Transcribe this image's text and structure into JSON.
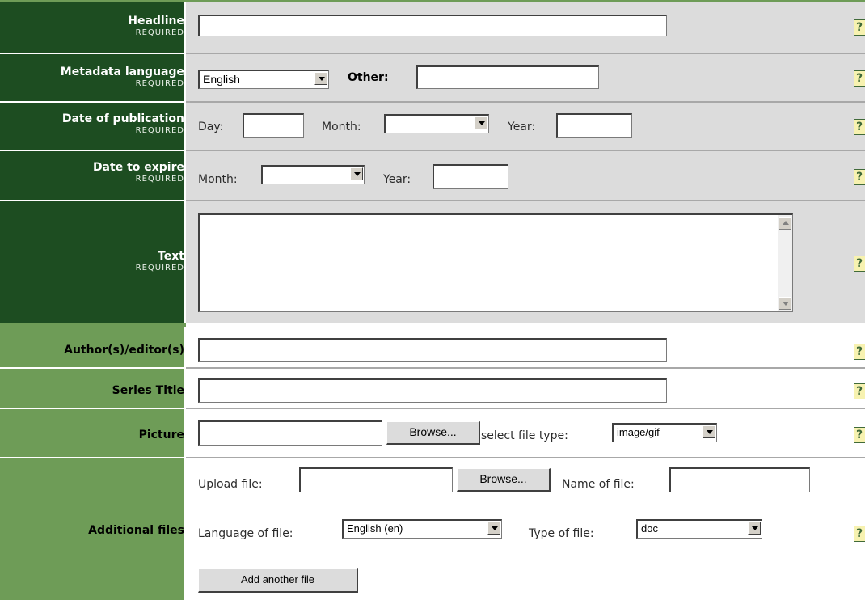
{
  "fields": {
    "headline": {
      "label": "Headline",
      "required": "REQUIRED",
      "value": ""
    },
    "metadata_language": {
      "label": "Metadata language",
      "required": "REQUIRED",
      "selected": "English",
      "other_label": "Other:",
      "other_value": ""
    },
    "date_of_publication": {
      "label": "Date of publication",
      "required": "REQUIRED",
      "day_label": "Day:",
      "day_value": "",
      "month_label": "Month:",
      "month_selected": "",
      "year_label": "Year:",
      "year_value": ""
    },
    "date_to_expire": {
      "label": "Date to expire",
      "required": "REQUIRED",
      "month_label": "Month:",
      "month_selected": "",
      "year_label": "Year:",
      "year_value": ""
    },
    "text": {
      "label": "Text",
      "required": "REQUIRED",
      "value": ""
    },
    "authors": {
      "label": "Author(s)/editor(s)",
      "value": ""
    },
    "series_title": {
      "label": "Series Title",
      "value": ""
    },
    "picture": {
      "label": "Picture",
      "value": "",
      "browse_label": "Browse...",
      "file_type_label": "select file type:",
      "file_type_selected": "image/gif"
    },
    "additional_files": {
      "label": "Additional files",
      "upload_label": "Upload file:",
      "upload_value": "",
      "browse_label": "Browse...",
      "name_label": "Name of file:",
      "name_value": "",
      "language_label": "Language of file:",
      "language_selected": "English  (en)",
      "type_label": "Type of file:",
      "type_selected": "doc",
      "add_button": "Add another file"
    }
  },
  "help": {
    "label": "?"
  },
  "colors": {
    "required_label_bg": "#1d4d21",
    "optional_label_bg": "#6e9c57",
    "field_bg_required": "#dcdcdc",
    "help_bg": "#f7f2b0"
  }
}
